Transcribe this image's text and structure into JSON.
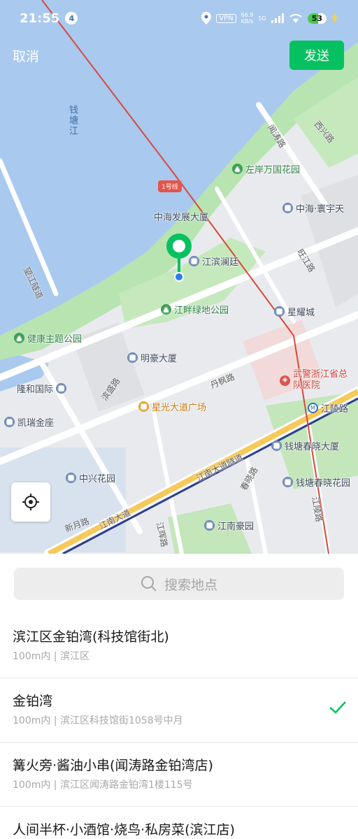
{
  "status_bar": {
    "time": "21:55",
    "notification_count": "4",
    "vpn": "VPN",
    "speed_value": "66.9",
    "speed_unit": "KB/s",
    "network": "5G",
    "battery": "53"
  },
  "top_bar": {
    "cancel_label": "取消",
    "send_label": "发送"
  },
  "map": {
    "water_label": "钱塘江",
    "metro_line_badge": "1号线",
    "pois": {
      "zuoan": "左岸万国花园",
      "xixing_road": "西兴路",
      "zhonghai_fazhan": "中海发展大厦",
      "zhonghai_huanyu": "中海·寰宇天",
      "jiangbin_lanting": "江滨澜廷",
      "jiangpan_park": "江畔绿地公园",
      "xingyao": "星耀城",
      "jiankang_park": "健康主题公园",
      "minghao": "明豪大厦",
      "hospital": "武警浙江省总队医院",
      "longhe": "隆和国际",
      "xingguang": "星光大道广场",
      "jiangling_station": "江陵路",
      "kairui": "凯瑞金座",
      "chunxiao_dasha": "钱塘春晓大厦",
      "zhongxing": "中兴花园",
      "chunxiao_garden": "钱塘春晓花园",
      "jiangnan_haoyuan": "江南豪园"
    },
    "roads": {
      "wangjiang_tunnel": "望江隧道",
      "wenyan_road": "闻涛路",
      "yuntao_road": "旺江路",
      "binsheng_road": "滨盛路",
      "danfeng_road": "丹枫路",
      "jiangnan_tunnel": "江南大道隧道",
      "chunxiao_road": "春晓路",
      "jiangnan_avenue": "江南大道",
      "xinyue_road": "新月路",
      "jianghui_road": "江晖路",
      "jiangling_road": "江陵路"
    },
    "icons": {
      "pin": "location-pin-icon",
      "locate": "locate-crosshair-icon"
    },
    "colors": {
      "water": "#a9c9ef",
      "park": "#b7e4b0",
      "road": "#ffffff",
      "metro": "#2c3e8f",
      "accent": "#07c160"
    }
  },
  "search": {
    "placeholder": "搜索地点"
  },
  "places": [
    {
      "name": "滨江区金铂湾(科技馆街北)",
      "address": "100m内 | 滨江区",
      "selected": false
    },
    {
      "name": "金铂湾",
      "address": "100m内 | 滨江区科技馆街1058号中月",
      "selected": true
    },
    {
      "name": "篝火旁·酱油小串(闻涛路金铂湾店)",
      "address": "100m内 | 滨江区闻涛路金铂湾1楼115号",
      "selected": false
    },
    {
      "name": "人间半杯·小酒馆·烧鸟·私房菜(滨江店)",
      "address": "",
      "selected": false
    }
  ]
}
